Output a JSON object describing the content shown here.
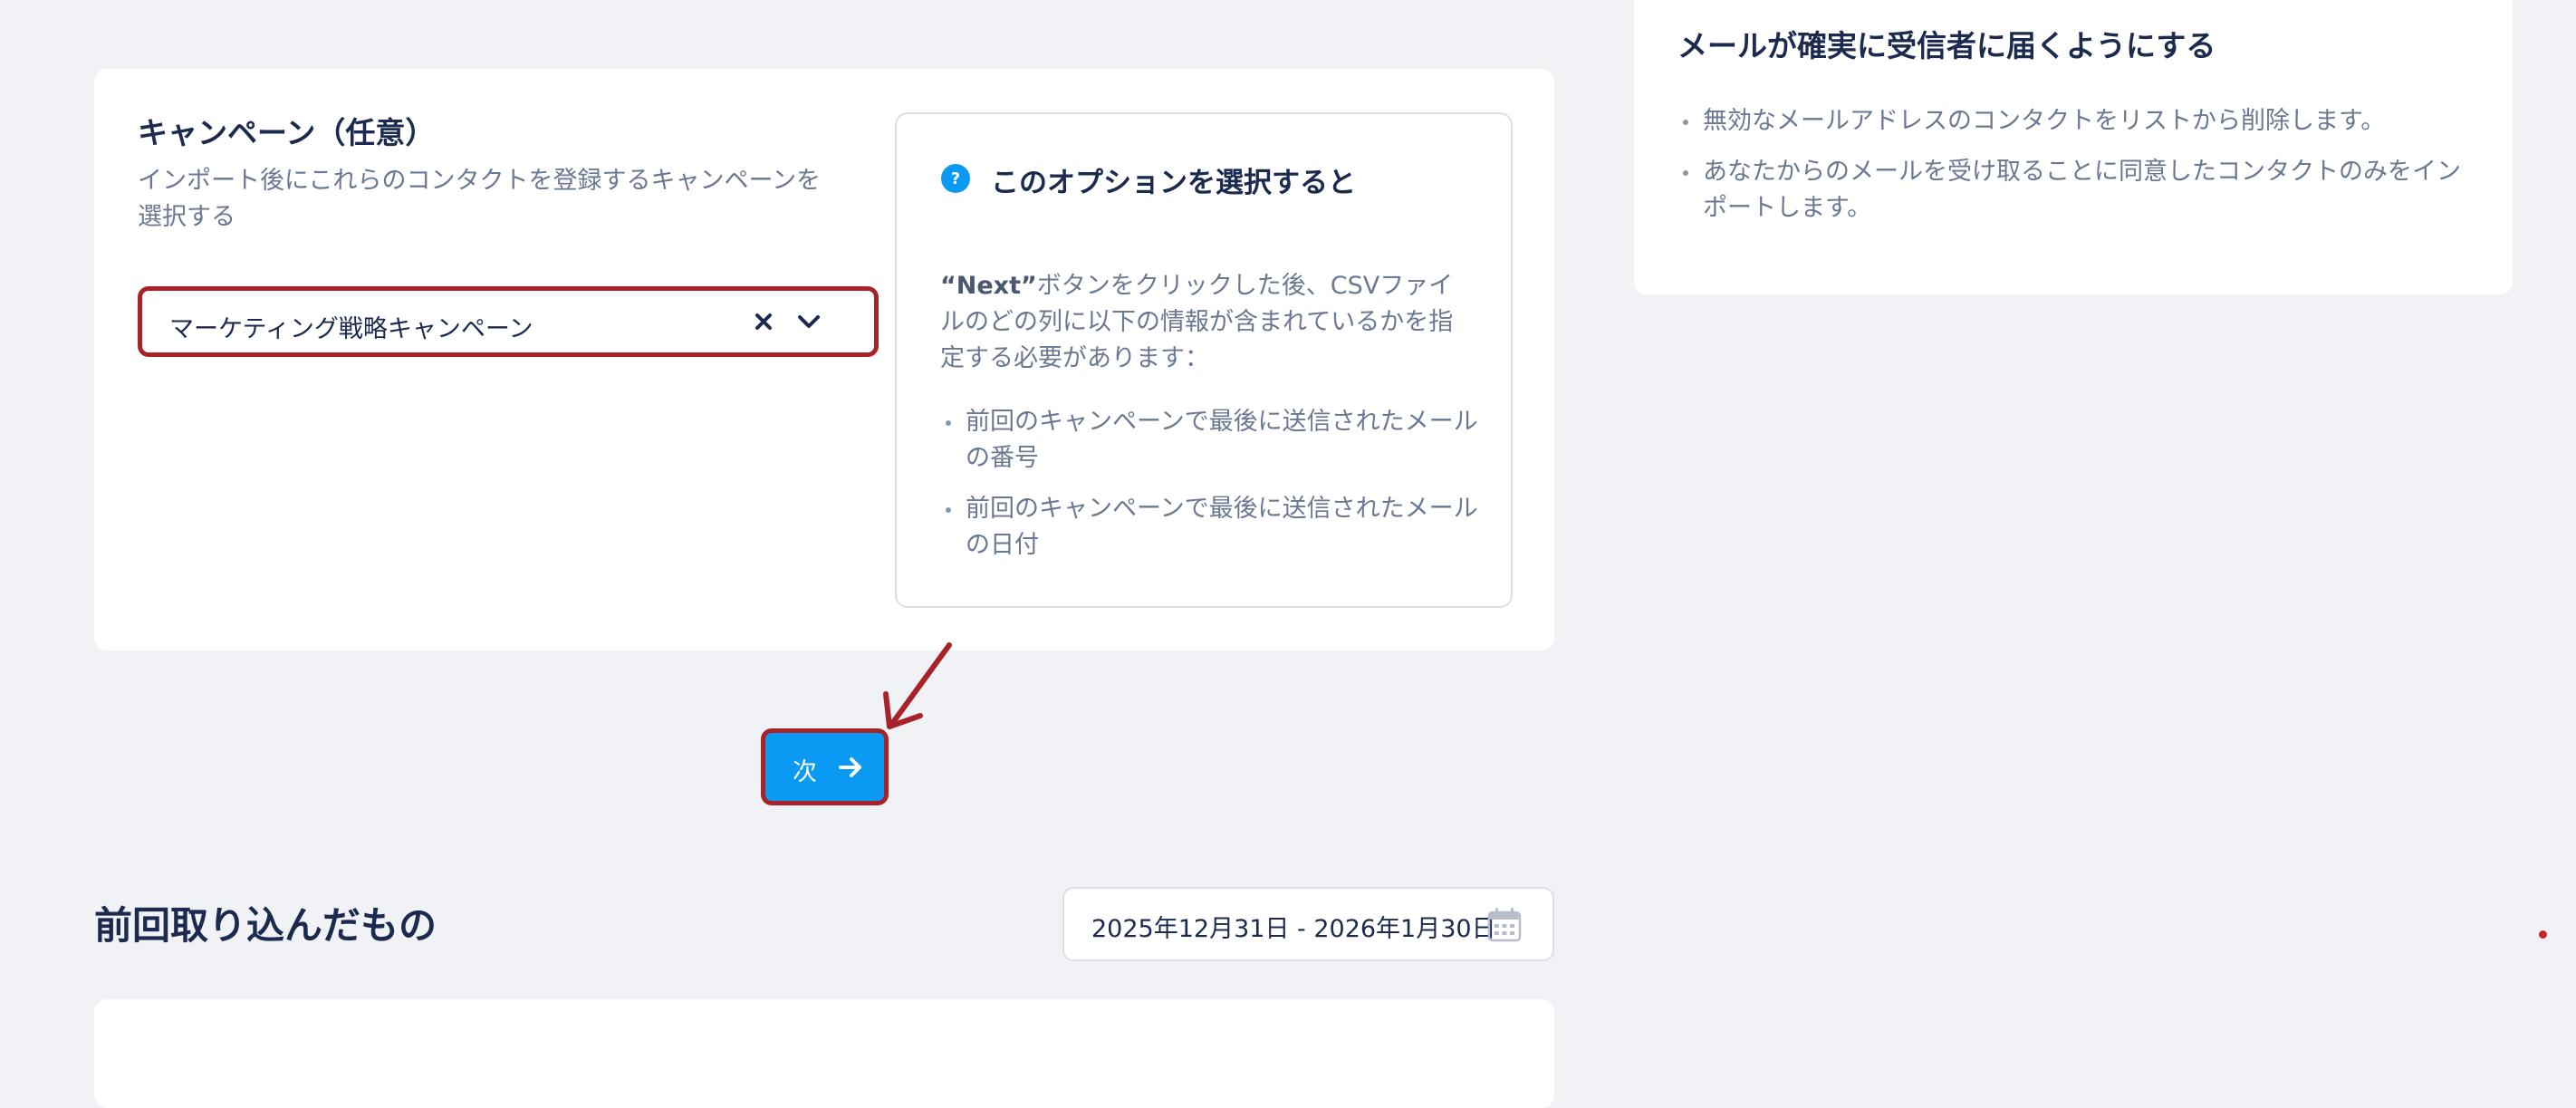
{
  "campaign_section": {
    "title": "キャンペーン（任意）",
    "description": "インポート後にこれらのコンタクトを登録するキャンペーンを選択する",
    "select": {
      "value": "マーケティング戦略キャンペーン",
      "clear_icon": "close-icon",
      "dropdown_icon": "chevron-down-icon"
    }
  },
  "info_box": {
    "icon": "question-circle-icon",
    "title": "このオプションを選択すると",
    "body_highlight": "“Next”",
    "body_text": "ボタンをクリックした後、CSVファイルのどの列に以下の情報が含まれているかを指定する必要があります：",
    "bullets": [
      "前回のキャンペーンで最後に送信されたメールの番号",
      "前回のキャンペーンで最後に送信されたメールの日付"
    ]
  },
  "tips_card": {
    "title": "メールが確実に受信者に届くようにする",
    "bullets": [
      "無効なメールアドレスのコンタクトをリストから削除します。",
      "あなたからのメールを受け取ることに同意したコンタクトのみをインポートします。"
    ]
  },
  "next_button": {
    "label": "次",
    "icon": "arrow-right-icon"
  },
  "history_section": {
    "title": "前回取り込んだもの",
    "date_range": "2025年12月31日 - 2026年1月30日",
    "calendar_icon": "calendar-icon"
  },
  "colors": {
    "page_background": "#f1f2f6",
    "card_background": "#ffffff",
    "heading_text": "#1b2a4e",
    "muted_text": "#6b7892",
    "primary_button": "#0a9af4",
    "annotation_red": "#a82329"
  }
}
